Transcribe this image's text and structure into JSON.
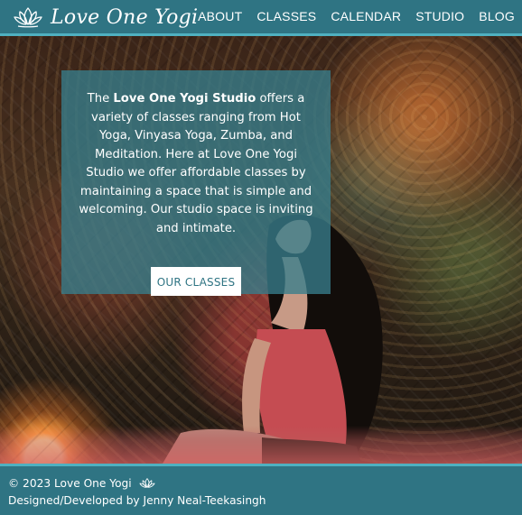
{
  "brand": {
    "name": "Love One Yogi",
    "logo_icon": "lotus-icon"
  },
  "nav": {
    "items": [
      "ABOUT",
      "CLASSES",
      "CALENDAR",
      "STUDIO",
      "BLOG"
    ]
  },
  "hero": {
    "text_before": "The ",
    "text_bold": "Love One Yogi Studio",
    "text_after": " offers a variety of classes ranging from Hot Yoga, Vinyasa Yoga, Zumba, and Meditation. Here at Love One Yogi Studio we offer affordable classes by maintaining a space that is simple and welcoming. Our studio space is inviting and intimate.",
    "button_label": "OUR CLASSES"
  },
  "footer": {
    "copyright": "© 2023 Love One Yogi",
    "icon": "lotus-icon",
    "credit": "Designed/Developed by Jenny Neal-Teekasingh"
  },
  "colors": {
    "header_bg": "#2f7483",
    "accent_border": "#4fb0c0",
    "overlay_box": "#377d8c",
    "button_text": "#2f7483"
  }
}
